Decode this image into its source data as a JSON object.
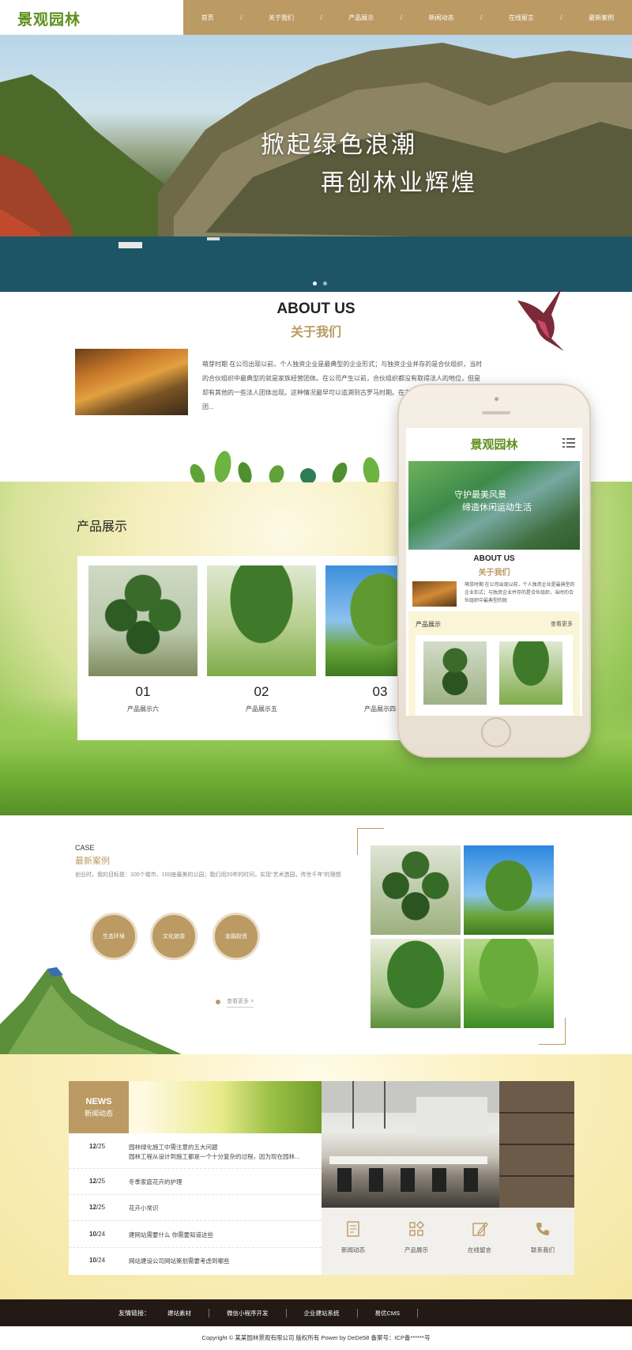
{
  "header": {
    "logo": "景观园林",
    "nav": [
      "首页",
      "关于我们",
      "产品展示",
      "新闻动态",
      "在线留言",
      "最新案例"
    ],
    "separator": "/"
  },
  "banner": {
    "line1": "掀起绿色浪潮",
    "line2": "再创林业辉煌",
    "slides_total": 2,
    "active_slide": 1
  },
  "about": {
    "title_en": "ABOUT US",
    "title_cn": "关于我们",
    "text": "萌芽时期 在公司出现以前，个人独资企业是最典型的企业形式；与独资企业并存的是合伙组织，当时的合伙组织中最典型的就是家族经营团体。在公司产生以前，合伙组织都没有取得法人的地位，但是却有其他的一些法人团体出现。这种情况最早可以追溯到古罗马时期。在古罗马，国家、地方自治团..."
  },
  "products": {
    "title": "产品展示",
    "items": [
      {
        "num": "01",
        "label": "产品展示六"
      },
      {
        "num": "02",
        "label": "产品展示五"
      },
      {
        "num": "03",
        "label": "产品展示四"
      }
    ]
  },
  "phone": {
    "logo": "景观园林",
    "banner_line1": "守护最美风景",
    "banner_line2": "缔造休闲运动生活",
    "about_en": "ABOUT US",
    "about_cn": "关于我们",
    "about_text": "萌芽时期 在公司出现以前，个人独资企业是最典型的企业形式；与独资企业并存的是合伙组织，当时的合伙组织中最典型的就",
    "prod_title": "产品展示",
    "prod_more": "查看更多"
  },
  "case": {
    "label_en": "CASE",
    "label_cn": "最新案例",
    "desc": "创业时，我的目标是：100个城市、100座最美的公园；我们用20年的时间，实现“艺术造园，传世千年”的理想",
    "circles": [
      "生态环境",
      "文化旅游",
      "金融投资"
    ],
    "more": "查看更多 >"
  },
  "news": {
    "tag_en": "NEWS",
    "tag_cn": "新闻动态",
    "items": [
      {
        "day": "12",
        "month": "/25",
        "title": "园林绿化施工中需注意的五大问题",
        "sub": "园林工程从设计到施工都是一个十分复杂的过程，因为现在园林..."
      },
      {
        "day": "12",
        "month": "/25",
        "title": "冬季家庭花卉的护理",
        "sub": ""
      },
      {
        "day": "12",
        "month": "/25",
        "title": "花卉小常识",
        "sub": ""
      },
      {
        "day": "10",
        "month": "/24",
        "title": "建网站需要什么 你需要知道这些",
        "sub": ""
      },
      {
        "day": "10",
        "month": "/24",
        "title": "网站建设公司网站策划需要考虑到哪些",
        "sub": ""
      }
    ],
    "quick": [
      {
        "label": "新闻动态",
        "icon": "document-icon"
      },
      {
        "label": "产品展示",
        "icon": "grid-icon"
      },
      {
        "label": "在线留言",
        "icon": "edit-icon"
      },
      {
        "label": "联系我们",
        "icon": "phone-icon"
      }
    ]
  },
  "footer": {
    "links_label": "友情链接：",
    "links": [
      "建站素材",
      "微信小程序开发",
      "企业建站系统",
      "易优CMS"
    ],
    "copyright": "Copyright © 某某园林景观有限公司 版权所有 Power by DeDe58 备案号：ICP备******号"
  },
  "colors": {
    "accent": "#bb9a63",
    "logo_green": "#5d8f1d",
    "footer_bg": "#231a15"
  }
}
